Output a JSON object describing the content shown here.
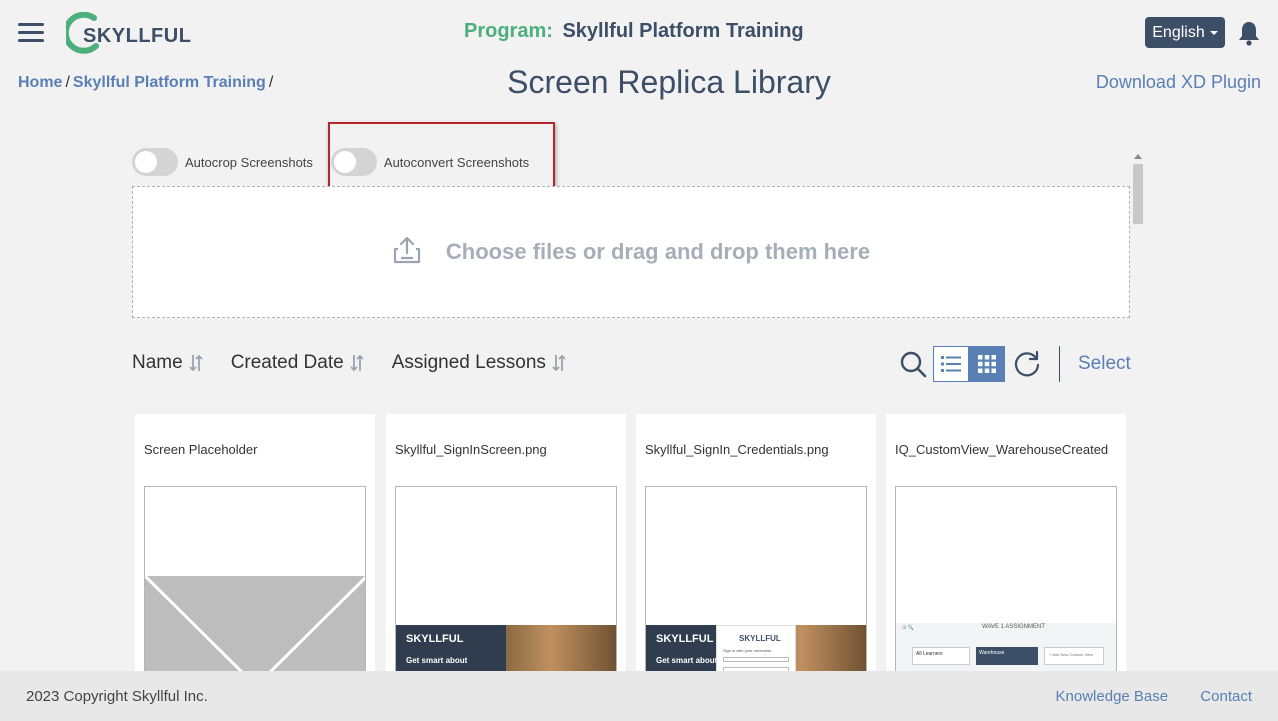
{
  "header": {
    "brand": "SKYLLFUL",
    "program_label": "Program:",
    "program_name": "Skyllful Platform Training",
    "language": "English"
  },
  "breadcrumb": {
    "items": [
      "Home",
      "Skyllful Platform Training"
    ],
    "separator": "/"
  },
  "page": {
    "title": "Screen Replica Library",
    "download_plugin": "Download XD Plugin"
  },
  "toggles": {
    "autocrop": {
      "label": "Autocrop Screenshots",
      "on": false
    },
    "autoconvert": {
      "label": "Autoconvert Screenshots",
      "on": false
    }
  },
  "dropzone": {
    "text": "Choose files or drag and drop them here"
  },
  "sort": {
    "name": "Name",
    "created_date": "Created Date",
    "assigned_lessons": "Assigned Lessons"
  },
  "toolbar": {
    "select": "Select",
    "active_view": "grid"
  },
  "cards": [
    {
      "title": "Screen Placeholder"
    },
    {
      "title": "Skyllful_SignInScreen.png",
      "thumb_logo": "SKYLLFUL",
      "thumb_text": "Get smart about"
    },
    {
      "title": "Skyllful_SignIn_Credentials.png",
      "thumb_logo": "SKYLLFUL",
      "thumb_text": "Get smart about",
      "popup_logo": "SKYLLFUL",
      "popup_text": "Sign in with your username"
    },
    {
      "title": "IQ_CustomView_WarehouseCreated",
      "thumb_heading": "WAVE 1 ASSIGNMENT",
      "thumb_tab1": "All Learners",
      "thumb_tab2": "Warehouse",
      "thumb_add": "+ Add New Custom View"
    }
  ],
  "footer": {
    "copyright": "2023 Copyright Skyllful Inc.",
    "knowledge_base": "Knowledge Base",
    "contact": "Contact"
  },
  "colors": {
    "brand_dark": "#3d4e67",
    "brand_green": "#4caf7d",
    "link_blue": "#5a7fb5",
    "highlight_red": "#b8262d"
  }
}
